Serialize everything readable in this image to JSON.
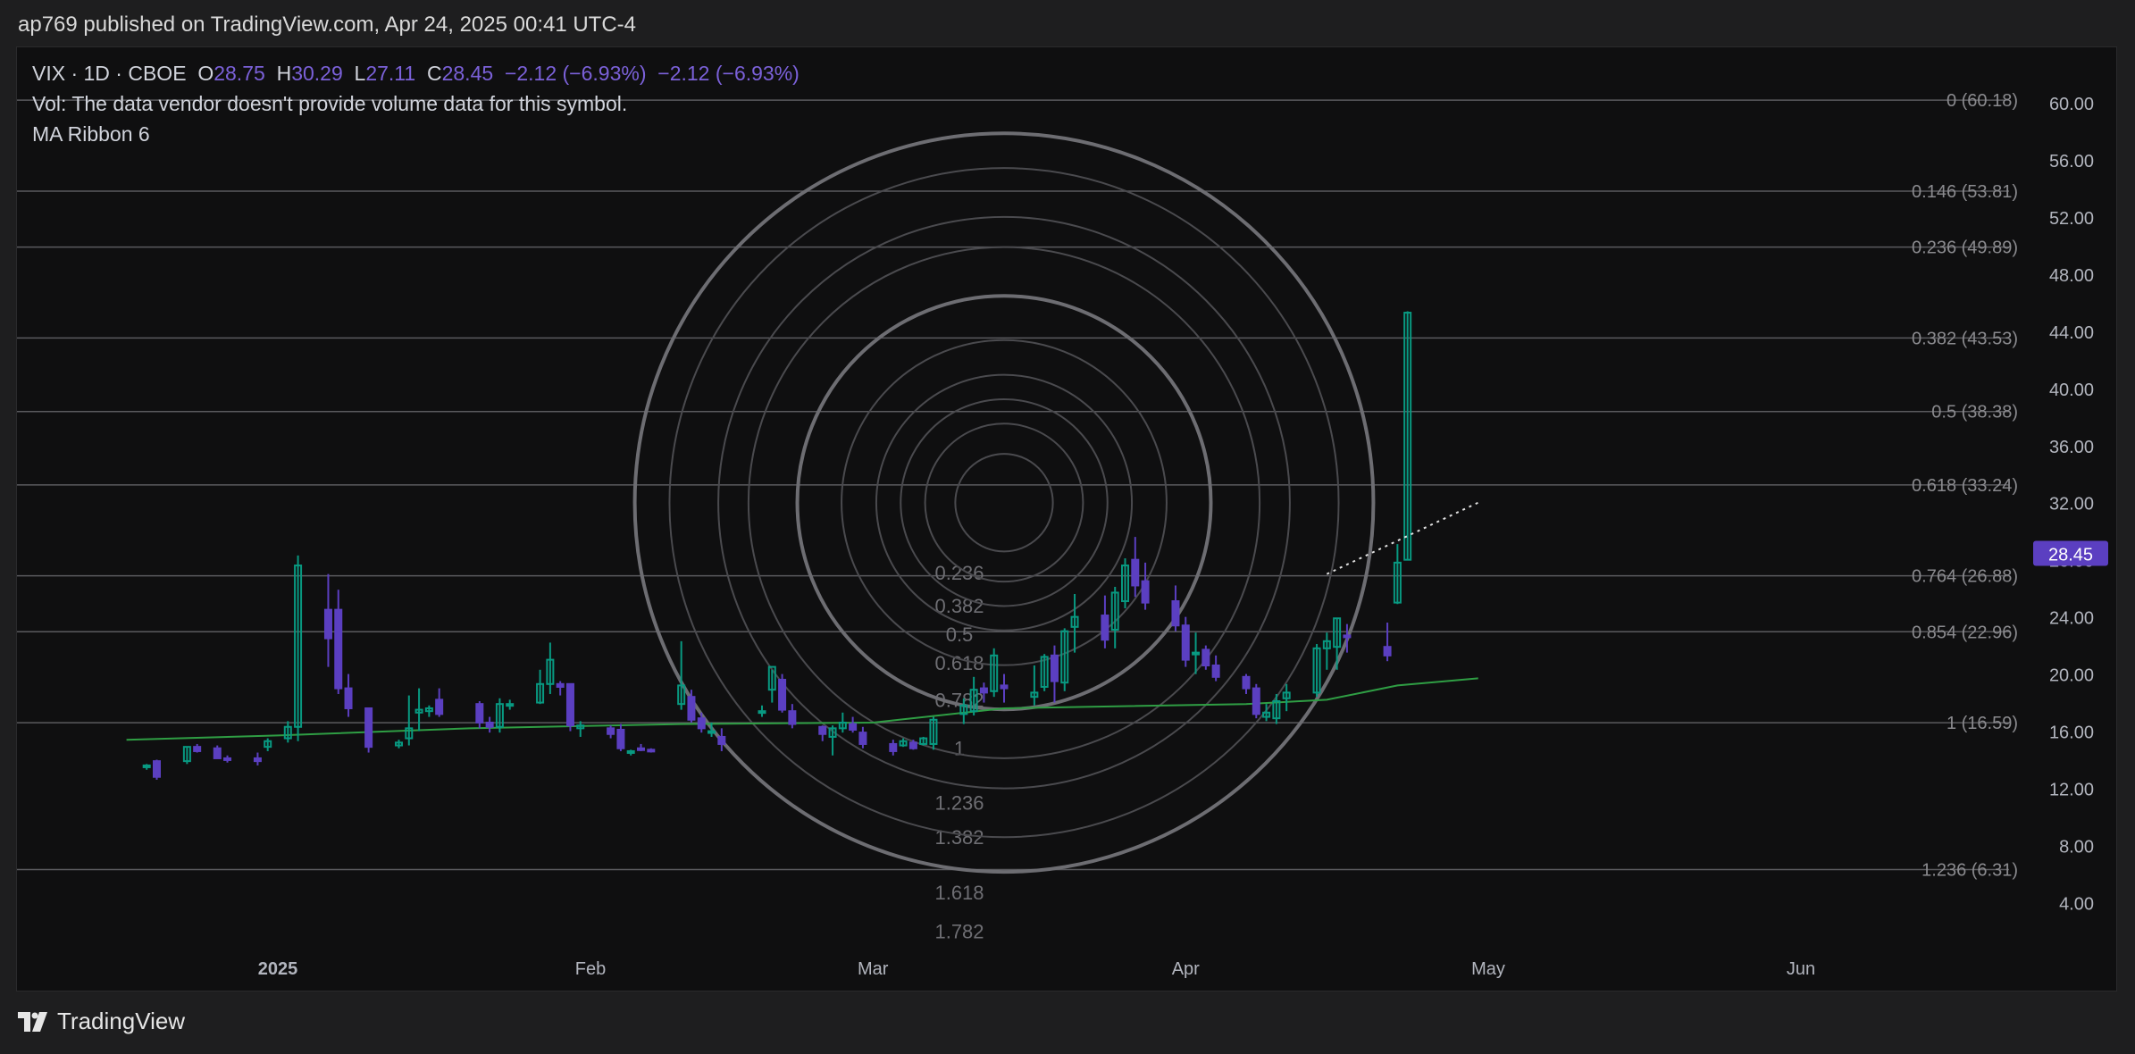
{
  "header": {
    "publish_line": "ap769 published on TradingView.com, Apr 24, 2025 00:41 UTC-4"
  },
  "legend": {
    "symbol_line": "VIX · 1D · CBOE",
    "o_label": "O",
    "o_value": "28.75",
    "h_label": "H",
    "h_value": "30.29",
    "l_label": "L",
    "l_value": "27.11",
    "c_label": "C",
    "c_value": "28.45",
    "change": "−2.12 (−6.93%)",
    "change2": "−2.12 (−6.93%)",
    "vol_note": "Vol: The data vendor doesn't provide volume data for this symbol.",
    "indicator": "MA Ribbon 6"
  },
  "footer": {
    "brand": "TradingView"
  },
  "colors": {
    "up": "#089981",
    "down": "#5b3fc1",
    "ma": "#2f9e44",
    "price_label": "#5b3fc1",
    "fib_line": "#5a5a5e",
    "circle": "#4a4a4e"
  },
  "chart_data": {
    "type": "candlestick",
    "symbol": "VIX",
    "interval": "1D",
    "exchange": "CBOE",
    "ylim": [
      0.5,
      63
    ],
    "y_ticks": [
      "60.00",
      "56.00",
      "52.00",
      "48.00",
      "44.00",
      "40.00",
      "36.00",
      "32.00",
      "28.00",
      "24.00",
      "20.00",
      "16.00",
      "12.00",
      "8.00",
      "4.00"
    ],
    "x_ticks": [
      {
        "label": "2025",
        "date": "2025-01-01",
        "bold": true
      },
      {
        "label": "Feb",
        "date": "2025-02-01",
        "bold": false
      },
      {
        "label": "Mar",
        "date": "2025-03-01",
        "bold": false
      },
      {
        "label": "Apr",
        "date": "2025-04-01",
        "bold": false
      },
      {
        "label": "May",
        "date": "2025-05-01",
        "bold": false
      },
      {
        "label": "Jun",
        "date": "2025-06-01",
        "bold": false
      }
    ],
    "last_price": "28.45",
    "fib_retracement": [
      {
        "label": "0 (60.18)",
        "value": 60.18
      },
      {
        "label": "0.146 (53.81)",
        "value": 53.81
      },
      {
        "label": "0.236 (49.89)",
        "value": 49.89
      },
      {
        "label": "0.382 (43.53)",
        "value": 43.53
      },
      {
        "label": "0.5 (38.38)",
        "value": 38.38
      },
      {
        "label": "0.618 (33.24)",
        "value": 33.24
      },
      {
        "label": "0.764 (26.88)",
        "value": 26.88
      },
      {
        "label": "0.854 (22.96)",
        "value": 22.96
      },
      {
        "label": "1 (16.59)",
        "value": 16.59
      },
      {
        "label": "1.236 (6.31)",
        "value": 6.31
      }
    ],
    "fib_circles": {
      "center_date": "2025-03-14",
      "center_value": 32,
      "levels": [
        {
          "ratio": 0.236,
          "label": "0.236",
          "label_value": 27.1
        },
        {
          "ratio": 0.382,
          "label": "0.382",
          "label_value": 24.8
        },
        {
          "ratio": 0.5,
          "label": "0.5",
          "label_value": 22.8
        },
        {
          "ratio": 0.618,
          "label": "0.618",
          "label_value": 20.8
        },
        {
          "ratio": 0.786,
          "label": "0.782",
          "label_value": 18.2
        },
        {
          "ratio": 1.0,
          "label": "1",
          "label_value": 14.8
        },
        {
          "ratio": 1.236,
          "label": "1.236",
          "label_value": 11.0
        },
        {
          "ratio": 1.382,
          "label": "1.382",
          "label_value": 8.6
        },
        {
          "ratio": 1.618,
          "label": "1.618",
          "label_value": 4.7
        },
        {
          "ratio": 1.786,
          "label": "1.782",
          "label_value": 2.0
        }
      ],
      "unit_x_days": 20.5
    },
    "trendline": {
      "from": {
        "date": "2025-04-15",
        "value": 27.0
      },
      "to": {
        "date": "2025-04-30",
        "value": 32.0
      }
    },
    "candles": [
      {
        "d": "2024-12-19",
        "o": 13.5,
        "h": 13.7,
        "l": 13.3,
        "c": 13.6
      },
      {
        "d": "2024-12-20",
        "o": 13.9,
        "h": 14.0,
        "l": 12.6,
        "c": 12.8
      },
      {
        "d": "2024-12-23",
        "o": 13.9,
        "h": 14.9,
        "l": 13.7,
        "c": 14.9
      },
      {
        "d": "2024-12-24",
        "o": 14.9,
        "h": 15.1,
        "l": 14.5,
        "c": 14.6
      },
      {
        "d": "2024-12-26",
        "o": 14.8,
        "h": 15.0,
        "l": 14.1,
        "c": 14.1
      },
      {
        "d": "2024-12-27",
        "o": 14.1,
        "h": 14.3,
        "l": 13.8,
        "c": 14.0
      },
      {
        "d": "2024-12-30",
        "o": 14.1,
        "h": 14.5,
        "l": 13.6,
        "c": 13.9
      },
      {
        "d": "2024-12-31",
        "o": 14.9,
        "h": 15.5,
        "l": 14.6,
        "c": 15.3
      },
      {
        "d": "2025-01-02",
        "o": 15.5,
        "h": 16.7,
        "l": 15.2,
        "c": 16.3
      },
      {
        "d": "2025-01-03",
        "o": 16.3,
        "h": 28.3,
        "l": 15.3,
        "c": 27.6
      },
      {
        "d": "2025-01-06",
        "o": 24.5,
        "h": 27.0,
        "l": 20.5,
        "c": 22.5
      },
      {
        "d": "2025-01-07",
        "o": 24.5,
        "h": 25.9,
        "l": 18.6,
        "c": 19.0
      },
      {
        "d": "2025-01-08",
        "o": 19.0,
        "h": 20.0,
        "l": 17.0,
        "c": 17.6
      },
      {
        "d": "2025-01-10",
        "o": 17.6,
        "h": 17.6,
        "l": 14.5,
        "c": 14.9
      },
      {
        "d": "2025-01-13",
        "o": 15.0,
        "h": 15.4,
        "l": 14.8,
        "c": 15.2
      },
      {
        "d": "2025-01-14",
        "o": 15.5,
        "h": 18.5,
        "l": 15.0,
        "c": 16.2
      },
      {
        "d": "2025-01-15",
        "o": 17.3,
        "h": 19.0,
        "l": 16.0,
        "c": 17.5
      },
      {
        "d": "2025-01-16",
        "o": 17.4,
        "h": 17.8,
        "l": 17.0,
        "c": 17.6
      },
      {
        "d": "2025-01-17",
        "o": 18.2,
        "h": 19.0,
        "l": 17.0,
        "c": 17.2
      },
      {
        "d": "2025-01-21",
        "o": 17.9,
        "h": 18.1,
        "l": 16.2,
        "c": 16.6
      },
      {
        "d": "2025-01-22",
        "o": 16.6,
        "h": 17.0,
        "l": 15.9,
        "c": 16.3
      },
      {
        "d": "2025-01-23",
        "o": 16.3,
        "h": 18.3,
        "l": 15.9,
        "c": 17.9
      },
      {
        "d": "2025-01-24",
        "o": 17.8,
        "h": 18.2,
        "l": 17.5,
        "c": 17.9
      },
      {
        "d": "2025-01-27",
        "o": 18.0,
        "h": 20.3,
        "l": 17.9,
        "c": 19.3
      },
      {
        "d": "2025-01-28",
        "o": 19.3,
        "h": 22.2,
        "l": 18.6,
        "c": 21.0
      },
      {
        "d": "2025-01-29",
        "o": 19.3,
        "h": 19.5,
        "l": 18.5,
        "c": 19.1
      },
      {
        "d": "2025-01-30",
        "o": 19.3,
        "h": 19.3,
        "l": 16.0,
        "c": 16.4
      },
      {
        "d": "2025-01-31",
        "o": 16.2,
        "h": 16.7,
        "l": 15.6,
        "c": 16.4
      },
      {
        "d": "2025-02-03",
        "o": 16.2,
        "h": 16.4,
        "l": 15.5,
        "c": 15.8
      },
      {
        "d": "2025-02-04",
        "o": 16.1,
        "h": 16.5,
        "l": 14.6,
        "c": 14.8
      },
      {
        "d": "2025-02-05",
        "o": 14.6,
        "h": 14.7,
        "l": 14.3,
        "c": 14.6
      },
      {
        "d": "2025-02-06",
        "o": 14.8,
        "h": 15.1,
        "l": 14.6,
        "c": 14.7
      },
      {
        "d": "2025-02-07",
        "o": 14.7,
        "h": 14.8,
        "l": 14.5,
        "c": 14.6
      },
      {
        "d": "2025-02-10",
        "o": 17.9,
        "h": 22.3,
        "l": 17.5,
        "c": 19.2
      },
      {
        "d": "2025-02-11",
        "o": 18.4,
        "h": 18.9,
        "l": 16.6,
        "c": 16.8
      },
      {
        "d": "2025-02-12",
        "o": 16.9,
        "h": 17.3,
        "l": 15.9,
        "c": 16.2
      },
      {
        "d": "2025-02-13",
        "o": 16.0,
        "h": 16.6,
        "l": 15.6,
        "c": 16.0
      },
      {
        "d": "2025-02-14",
        "o": 15.6,
        "h": 16.2,
        "l": 14.6,
        "c": 15.1
      },
      {
        "d": "2025-02-18",
        "o": 17.4,
        "h": 17.8,
        "l": 17.0,
        "c": 17.4
      },
      {
        "d": "2025-02-19",
        "o": 18.9,
        "h": 20.3,
        "l": 18.0,
        "c": 20.5
      },
      {
        "d": "2025-02-20",
        "o": 19.6,
        "h": 20.0,
        "l": 17.3,
        "c": 17.5
      },
      {
        "d": "2025-02-21",
        "o": 17.4,
        "h": 17.9,
        "l": 16.2,
        "c": 16.5
      },
      {
        "d": "2025-02-24",
        "o": 16.3,
        "h": 16.4,
        "l": 15.3,
        "c": 15.8
      },
      {
        "d": "2025-02-25",
        "o": 15.6,
        "h": 16.4,
        "l": 14.3,
        "c": 16.2
      },
      {
        "d": "2025-02-26",
        "o": 16.2,
        "h": 17.3,
        "l": 15.9,
        "c": 16.6
      },
      {
        "d": "2025-02-27",
        "o": 16.5,
        "h": 17.0,
        "l": 15.9,
        "c": 16.1
      },
      {
        "d": "2025-02-28",
        "o": 15.9,
        "h": 16.3,
        "l": 14.8,
        "c": 15.1
      },
      {
        "d": "2025-03-03",
        "o": 15.1,
        "h": 15.4,
        "l": 14.3,
        "c": 14.6
      },
      {
        "d": "2025-03-04",
        "o": 15.0,
        "h": 15.5,
        "l": 14.9,
        "c": 15.3
      },
      {
        "d": "2025-03-05",
        "o": 15.2,
        "h": 15.4,
        "l": 14.7,
        "c": 14.8
      },
      {
        "d": "2025-03-06",
        "o": 15.1,
        "h": 15.6,
        "l": 15.0,
        "c": 15.5
      },
      {
        "d": "2025-03-07",
        "o": 15.1,
        "h": 17.0,
        "l": 14.7,
        "c": 16.8
      },
      {
        "d": "2025-03-10",
        "o": 17.2,
        "h": 18.3,
        "l": 16.5,
        "c": 17.8
      },
      {
        "d": "2025-03-11",
        "o": 17.4,
        "h": 19.8,
        "l": 17.1,
        "c": 18.9
      },
      {
        "d": "2025-03-12",
        "o": 19.0,
        "h": 19.4,
        "l": 18.0,
        "c": 18.7
      },
      {
        "d": "2025-03-13",
        "o": 18.8,
        "h": 21.8,
        "l": 18.4,
        "c": 21.3
      },
      {
        "d": "2025-03-14",
        "o": 19.2,
        "h": 20.0,
        "l": 18.0,
        "c": 19.0
      },
      {
        "d": "2025-03-17",
        "o": 18.4,
        "h": 20.6,
        "l": 17.8,
        "c": 18.7
      },
      {
        "d": "2025-03-18",
        "o": 19.1,
        "h": 21.4,
        "l": 18.8,
        "c": 21.2
      },
      {
        "d": "2025-03-19",
        "o": 21.3,
        "h": 22.0,
        "l": 18.0,
        "c": 19.5
      },
      {
        "d": "2025-03-20",
        "o": 19.4,
        "h": 23.2,
        "l": 18.8,
        "c": 23.0
      },
      {
        "d": "2025-03-21",
        "o": 23.3,
        "h": 25.6,
        "l": 21.5,
        "c": 24.0
      },
      {
        "d": "2025-03-24",
        "o": 24.1,
        "h": 25.5,
        "l": 21.8,
        "c": 22.4
      },
      {
        "d": "2025-03-25",
        "o": 23.1,
        "h": 26.1,
        "l": 21.8,
        "c": 25.7
      },
      {
        "d": "2025-03-26",
        "o": 25.1,
        "h": 28.1,
        "l": 24.6,
        "c": 27.6
      },
      {
        "d": "2025-03-27",
        "o": 28.0,
        "h": 29.6,
        "l": 25.4,
        "c": 26.2
      },
      {
        "d": "2025-03-28",
        "o": 26.5,
        "h": 27.8,
        "l": 24.5,
        "c": 25.0
      },
      {
        "d": "2025-03-31",
        "o": 25.1,
        "h": 26.2,
        "l": 23.0,
        "c": 23.4
      },
      {
        "d": "2025-04-01",
        "o": 23.4,
        "h": 24.0,
        "l": 20.5,
        "c": 21.0
      },
      {
        "d": "2025-04-02",
        "o": 21.4,
        "h": 22.9,
        "l": 20.0,
        "c": 21.5
      },
      {
        "d": "2025-04-03",
        "o": 21.7,
        "h": 22.0,
        "l": 20.3,
        "c": 20.6
      },
      {
        "d": "2025-04-04",
        "o": 20.6,
        "h": 21.3,
        "l": 19.5,
        "c": 19.8
      },
      {
        "d": "2025-04-07",
        "o": 19.8,
        "h": 20.0,
        "l": 18.6,
        "c": 19.0
      },
      {
        "d": "2025-04-08",
        "o": 19.0,
        "h": 19.3,
        "l": 16.9,
        "c": 17.2
      },
      {
        "d": "2025-04-09",
        "o": 17.0,
        "h": 17.9,
        "l": 16.7,
        "c": 17.3
      },
      {
        "d": "2025-04-10",
        "o": 16.9,
        "h": 18.6,
        "l": 16.5,
        "c": 18.1
      },
      {
        "d": "2025-04-11",
        "o": 18.3,
        "h": 19.3,
        "l": 17.4,
        "c": 18.7
      },
      {
        "d": "2025-04-14",
        "o": 18.7,
        "h": 22.1,
        "l": 18.4,
        "c": 21.8
      },
      {
        "d": "2025-04-15",
        "o": 21.8,
        "h": 22.9,
        "l": 20.3,
        "c": 22.3
      },
      {
        "d": "2025-04-16",
        "o": 21.9,
        "h": 23.9,
        "l": 20.3,
        "c": 23.9
      },
      {
        "d": "2025-04-17",
        "o": 22.7,
        "h": 23.5,
        "l": 21.5,
        "c": 22.6
      },
      {
        "d": "2025-04-21",
        "o": 21.9,
        "h": 23.6,
        "l": 20.9,
        "c": 21.3
      },
      {
        "d": "2025-04-22",
        "o": 25.0,
        "h": 29.1,
        "l": 24.9,
        "c": 27.8
      },
      {
        "d": "2025-04-23",
        "o": 28.0,
        "h": 45.4,
        "l": 28.0,
        "c": 45.3
      }
    ],
    "candles_note_end": "",
    "ma_line": [
      {
        "d": "2024-12-17",
        "v": 15.4
      },
      {
        "d": "2025-01-01",
        "v": 15.7
      },
      {
        "d": "2025-01-20",
        "v": 16.2
      },
      {
        "d": "2025-02-10",
        "v": 16.5
      },
      {
        "d": "2025-03-01",
        "v": 16.6
      },
      {
        "d": "2025-03-14",
        "v": 17.6
      },
      {
        "d": "2025-04-07",
        "v": 17.9
      },
      {
        "d": "2025-04-15",
        "v": 18.2
      },
      {
        "d": "2025-04-22",
        "v": 19.2
      },
      {
        "d": "2025-04-30",
        "v": 19.7
      }
    ]
  }
}
